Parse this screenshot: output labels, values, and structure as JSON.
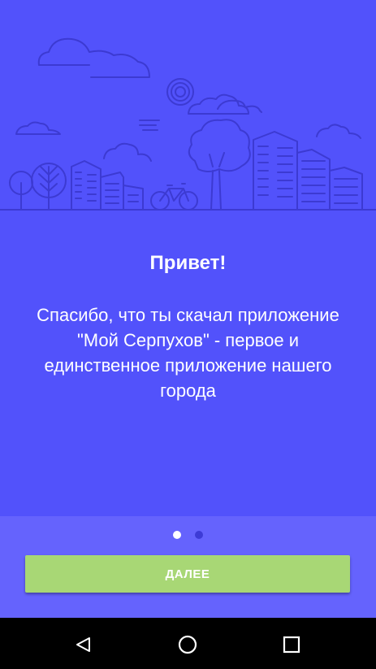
{
  "onboarding": {
    "title": "Привет!",
    "message": "Спасибо, что ты скачал приложение \"Мой Серпухов\" - первое и единственное приложение нашего города",
    "illustration": "city-skyline-illustration",
    "page_indicator": {
      "current": 1,
      "total": 2
    },
    "next_label": "ДАЛЕЕ"
  },
  "navigation_bar": {
    "icons": [
      "back-icon",
      "home-icon",
      "recent-apps-icon"
    ]
  },
  "colors": {
    "hero_background": "#5252fb",
    "footer_background": "#6563fd",
    "button": "#a8d775",
    "dot_active": "#ffffff",
    "dot_inactive": "#3d3bd6",
    "illustration_stroke": "#3c3ad2"
  }
}
